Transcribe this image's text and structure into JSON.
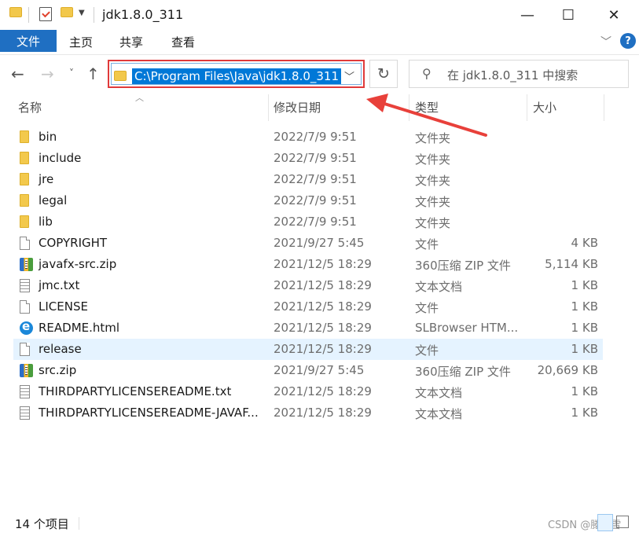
{
  "window": {
    "title": "jdk1.8.0_311",
    "minimize_glyph": "—",
    "maximize_glyph": "☐",
    "close_glyph": "✕"
  },
  "ribbon": {
    "file_tab": "文件",
    "tabs": [
      "主页",
      "共享",
      "查看"
    ],
    "help_glyph": "?"
  },
  "nav": {
    "address_path": "C:\\Program Files\\Java\\jdk1.8.0_311",
    "search_placeholder": "在 jdk1.8.0_311 中搜索"
  },
  "columns": {
    "name": "名称",
    "date": "修改日期",
    "type": "类型",
    "size": "大小"
  },
  "files": [
    {
      "name": "bin",
      "date": "2022/7/9 9:51",
      "type": "文件夹",
      "size": "",
      "icon": "folder-icon"
    },
    {
      "name": "include",
      "date": "2022/7/9 9:51",
      "type": "文件夹",
      "size": "",
      "icon": "folder-icon"
    },
    {
      "name": "jre",
      "date": "2022/7/9 9:51",
      "type": "文件夹",
      "size": "",
      "icon": "folder-icon"
    },
    {
      "name": "legal",
      "date": "2022/7/9 9:51",
      "type": "文件夹",
      "size": "",
      "icon": "folder-icon"
    },
    {
      "name": "lib",
      "date": "2022/7/9 9:51",
      "type": "文件夹",
      "size": "",
      "icon": "folder-icon"
    },
    {
      "name": "COPYRIGHT",
      "date": "2021/9/27 5:45",
      "type": "文件",
      "size": "4 KB",
      "icon": "file-icon"
    },
    {
      "name": "javafx-src.zip",
      "date": "2021/12/5 18:29",
      "type": "360压缩 ZIP 文件",
      "size": "5,114 KB",
      "icon": "zip-icon"
    },
    {
      "name": "jmc.txt",
      "date": "2021/12/5 18:29",
      "type": "文本文档",
      "size": "1 KB",
      "icon": "text-file-icon"
    },
    {
      "name": "LICENSE",
      "date": "2021/12/5 18:29",
      "type": "文件",
      "size": "1 KB",
      "icon": "file-icon"
    },
    {
      "name": "README.html",
      "date": "2021/12/5 18:29",
      "type": "SLBrowser HTM...",
      "size": "1 KB",
      "icon": "browser-icon"
    },
    {
      "name": "release",
      "date": "2021/12/5 18:29",
      "type": "文件",
      "size": "1 KB",
      "icon": "file-icon",
      "selected": true
    },
    {
      "name": "src.zip",
      "date": "2021/9/27 5:45",
      "type": "360压缩 ZIP 文件",
      "size": "20,669 KB",
      "icon": "zip-icon"
    },
    {
      "name": "THIRDPARTYLICENSEREADME.txt",
      "date": "2021/12/5 18:29",
      "type": "文本文档",
      "size": "1 KB",
      "icon": "text-file-icon"
    },
    {
      "name": "THIRDPARTYLICENSEREADME-JAVAF...",
      "date": "2021/12/5 18:29",
      "type": "文本文档",
      "size": "1 KB",
      "icon": "text-file-icon"
    }
  ],
  "status": {
    "item_count": "14 个项目",
    "watermark": "CSDN @滕鱼雪"
  },
  "colors": {
    "accent": "#1f6fc2",
    "selection": "#0078d7",
    "highlight_box": "#e03a3a",
    "row_hover": "#e5f3ff"
  }
}
